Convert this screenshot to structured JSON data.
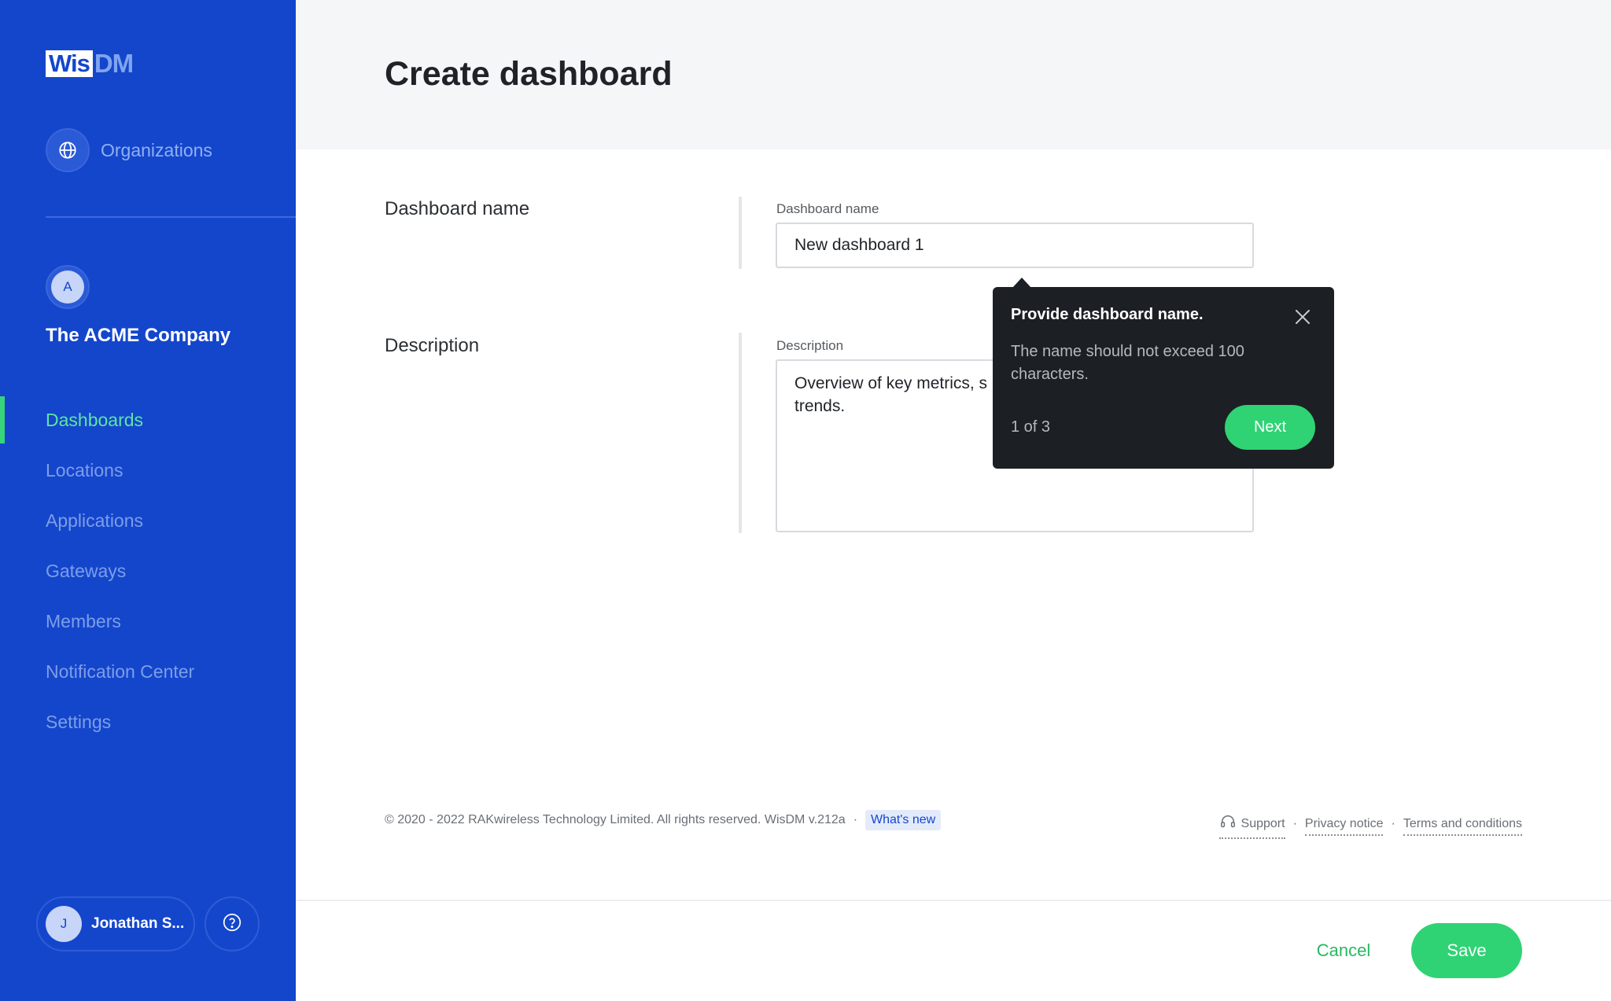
{
  "app": {
    "logo_left": "Wis",
    "logo_right": "DM"
  },
  "sidebar": {
    "organizations_label": "Organizations",
    "organizations_icon": "globe-icon",
    "company_initial": "A",
    "company_name": "The ACME Company",
    "items": [
      {
        "label": "Dashboards",
        "active": true
      },
      {
        "label": "Locations",
        "active": false
      },
      {
        "label": "Applications",
        "active": false
      },
      {
        "label": "Gateways",
        "active": false
      },
      {
        "label": "Members",
        "active": false
      },
      {
        "label": "Notification Center",
        "active": false
      },
      {
        "label": "Settings",
        "active": false
      }
    ],
    "user_initial": "J",
    "user_name": "Jonathan S...",
    "help_icon": "help-circle-icon"
  },
  "page": {
    "title": "Create dashboard"
  },
  "form": {
    "name_section_label": "Dashboard name",
    "name_field_label": "Dashboard name",
    "name_value": "New dashboard 1",
    "description_section_label": "Description",
    "description_field_label": "Description",
    "description_value": "Overview of key metrics, s\ntrends."
  },
  "tooltip": {
    "title": "Provide dashboard name.",
    "body": "The name should not exceed 100 characters.",
    "step": "1 of 3",
    "next_label": "Next",
    "close_icon": "close-icon"
  },
  "footer": {
    "copyright": "© 2020 - 2022 RAKwireless Technology Limited. All rights reserved. WisDM v.212a",
    "separator": "·",
    "whats_new": "What's new",
    "support": "Support",
    "privacy": "Privacy notice",
    "terms": "Terms and conditions"
  },
  "actions": {
    "cancel_label": "Cancel",
    "save_label": "Save"
  },
  "colors": {
    "sidebar_bg": "#1446cc",
    "accent_green": "#2fd374",
    "active_nav": "#5ee6a0",
    "tooltip_bg": "#1c2024"
  }
}
